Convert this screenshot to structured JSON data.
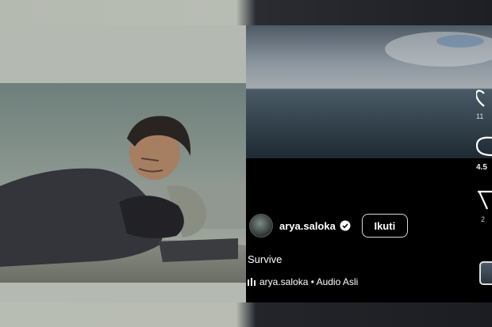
{
  "post": {
    "username": "arya.saloka",
    "follow_label": "Ikuti",
    "caption": "Survive",
    "audio_text": "arya.saloka • Audio Asli"
  },
  "actions": {
    "like_count": "11",
    "comment_count": "4.5",
    "share_count": "2"
  },
  "icons": {
    "verified": "verified-badge-icon",
    "audio": "audio-bars-icon",
    "like": "heart-icon",
    "comment": "comment-icon",
    "share": "send-icon"
  },
  "colors": {
    "left_background": "#b4bab1",
    "reel_background": "#000000",
    "sea": "#2f4552",
    "sky": "#8f9aa4"
  }
}
